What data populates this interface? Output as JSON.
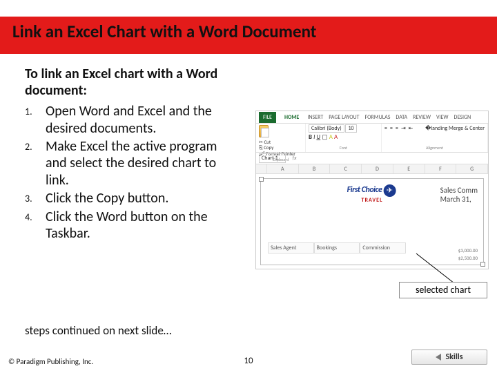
{
  "title": "Link an Excel Chart with a Word Document",
  "intro": "To link an Excel chart with a Word document:",
  "steps": {
    "s1": "Open Word and Excel and the desired documents.",
    "s2": "Make Excel the active program and select the desired chart to link.",
    "s3": "Click the Copy button.",
    "s4": "Click the Word button on the Taskbar."
  },
  "continued": "steps continued on next slide…",
  "copyright": "© Paradigm Publishing, Inc.",
  "page": "10",
  "callout": "selected chart",
  "skills_label": "Skills",
  "excel": {
    "tabs": {
      "file": "FILE",
      "home": "HOME",
      "insert": "INSERT",
      "layout": "PAGE LAYOUT",
      "formulas": "FORMULAS",
      "data": "DATA",
      "review": "REVIEW",
      "view": "VIEW",
      "design": "DESIGN"
    },
    "clipboard": {
      "cut": "Cut",
      "copy": "Copy",
      "painter": "Format Painter",
      "paste": "Paste",
      "group": "Clipboard"
    },
    "font": {
      "name": "Calibri (Body)",
      "size": "10",
      "group": "Font"
    },
    "align": {
      "merge": "Merge & Center",
      "group": "Alignment"
    },
    "namebox": "Chart 1",
    "fx": "fx",
    "cols": {
      "a": "A",
      "b": "B",
      "c": "C",
      "d": "D",
      "e": "E",
      "f": "F",
      "g": "G"
    },
    "logo": {
      "line1": "First Choice",
      "line2": "TRAVEL",
      "plane": "✈"
    },
    "chart_title": {
      "l1": "Sales Comm",
      "l2": "March 31,"
    },
    "headers": {
      "agent": "Sales Agent",
      "bookings": "Bookings",
      "commission": "Commission"
    },
    "ticks": {
      "t1": "$3,000.00",
      "t2": "$2,500.00"
    }
  }
}
